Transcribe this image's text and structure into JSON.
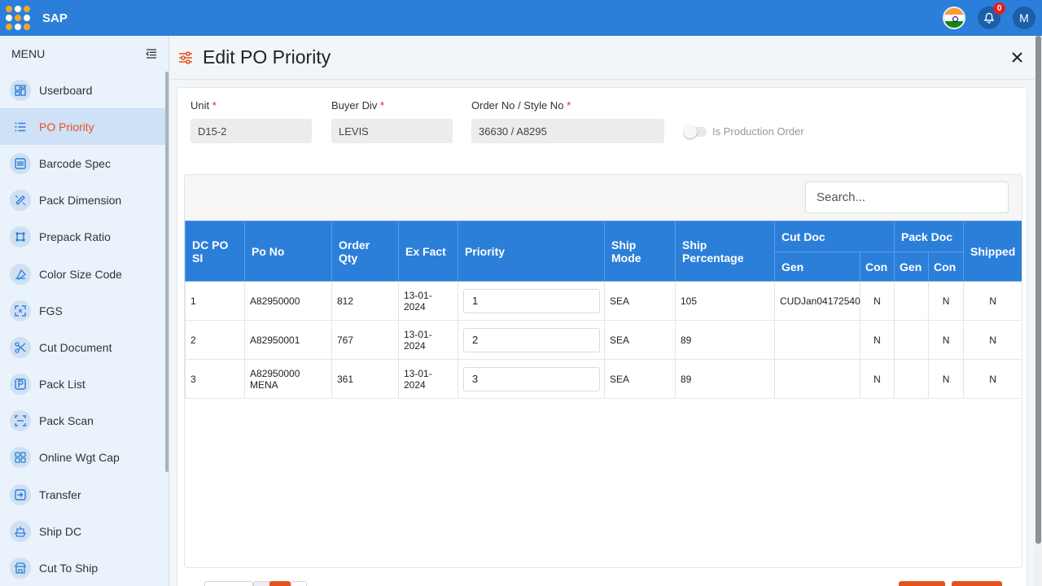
{
  "app": {
    "name": "SAP",
    "notification_count": "0",
    "avatar_initial": "M"
  },
  "sidebar": {
    "title": "MENU",
    "items": [
      {
        "label": "Userboard",
        "icon": "dashboard-icon"
      },
      {
        "label": "PO Priority",
        "icon": "list-icon",
        "active": true
      },
      {
        "label": "Barcode Spec",
        "icon": "barcode-icon"
      },
      {
        "label": "Pack Dimension",
        "icon": "ruler-icon"
      },
      {
        "label": "Prepack Ratio",
        "icon": "crop-icon"
      },
      {
        "label": "Color Size Code",
        "icon": "color-drop-icon"
      },
      {
        "label": "FGS",
        "icon": "expand-icon"
      },
      {
        "label": "Cut Document",
        "icon": "scissors-icon"
      },
      {
        "label": "Pack List",
        "icon": "p-box-icon"
      },
      {
        "label": "Pack Scan",
        "icon": "scan-icon"
      },
      {
        "label": "Online Wgt Cap",
        "icon": "grid-icon"
      },
      {
        "label": "Transfer",
        "icon": "transfer-icon"
      },
      {
        "label": "Ship DC",
        "icon": "ship-icon"
      },
      {
        "label": "Cut To Ship",
        "icon": "shop-icon"
      }
    ]
  },
  "page": {
    "title": "Edit PO Priority"
  },
  "form": {
    "unit_label": "Unit",
    "unit_value": "D15-2",
    "buyer_label": "Buyer Div",
    "buyer_value": "LEVIS",
    "order_label": "Order No / Style No",
    "order_value": "36630 / A8295",
    "production_label": "Is Production Order"
  },
  "table": {
    "search_placeholder": "Search...",
    "headers": {
      "dc_po_si": "DC PO SI",
      "po_no": "Po No",
      "order_qty": "Order Qty",
      "ex_fact": "Ex Fact",
      "priority": "Priority",
      "ship_mode": "Ship Mode",
      "ship_pct": "Ship Percentage",
      "cut_doc": "Cut Doc",
      "pack_doc": "Pack Doc",
      "shipped": "Shipped",
      "gen": "Gen",
      "con": "Con"
    },
    "rows": [
      {
        "si": "1",
        "po_no": "A82950000",
        "qty": "812",
        "ex_fact": "13-01-2024",
        "priority": "1",
        "ship_mode": "SEA",
        "pct": "105",
        "cut_gen": "CUDJan04172540",
        "cut_con": "N",
        "pack_gen": "",
        "pack_con": "N",
        "shipped": "N"
      },
      {
        "si": "2",
        "po_no": "A82950001",
        "qty": "767",
        "ex_fact": "13-01-2024",
        "priority": "2",
        "ship_mode": "SEA",
        "pct": "89",
        "cut_gen": "",
        "cut_con": "N",
        "pack_gen": "",
        "pack_con": "N",
        "shipped": "N"
      },
      {
        "si": "3",
        "po_no": "A82950000 MENA",
        "qty": "361",
        "ex_fact": "13-01-2024",
        "priority": "3",
        "ship_mode": "SEA",
        "pct": "89",
        "cut_gen": "",
        "cut_con": "N",
        "pack_gen": "",
        "pack_con": "N",
        "shipped": "N"
      }
    ]
  },
  "colors": {
    "primary": "#2b7fd9",
    "accent": "#e8501c",
    "sidebar_bg": "#eaf2fb"
  }
}
